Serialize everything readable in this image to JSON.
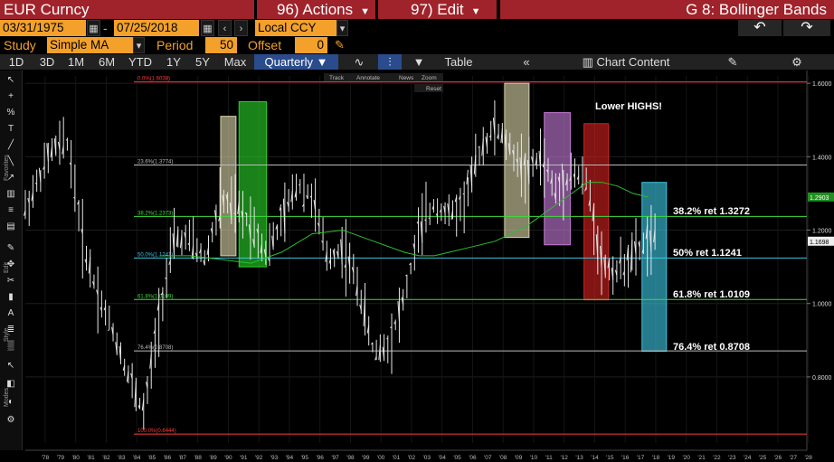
{
  "header": {
    "title": "EUR Curncy",
    "actions_label": "96) Actions",
    "edit_label": "97) Edit",
    "graph_title": "G 8: Bollinger Bands"
  },
  "date_range": {
    "start": "03/31/1975",
    "separator": "-",
    "end": "07/25/2018",
    "currency": "Local CCY"
  },
  "study": {
    "label": "Study",
    "value": "Simple MA",
    "period_label": "Period",
    "period_value": "50",
    "offset_label": "Offset",
    "offset_value": "0"
  },
  "toolbar": {
    "ranges": [
      "1D",
      "3D",
      "1M",
      "6M",
      "YTD",
      "1Y",
      "5Y",
      "Max"
    ],
    "frequency": "Quarterly",
    "table_label": "Table",
    "chart_content_label": "Chart Content"
  },
  "chart_tools": {
    "track": "Track",
    "annotate": "Annotate",
    "news": "News",
    "zoom": "Zoom",
    "reset": "Reset"
  },
  "side_labels": {
    "favorites": "Favorites",
    "edit": "Edit",
    "style": "Style",
    "modes": "Modes"
  },
  "annotations": {
    "lower_highs": "Lower HIGHS!",
    "ret382": "38.2% ret 1.3272",
    "ret50": "50% ret 1.1241",
    "ret618": "61.8% ret 1.0109",
    "ret764": "76.4% ret 0.8708"
  },
  "chart_data": {
    "type": "candlestick",
    "title": "",
    "ylim": [
      0.62,
      1.62
    ],
    "y_ticks": [
      "0.8000",
      "1.0000",
      "1.2000",
      "1.4000",
      "1.6000"
    ],
    "x_ticks": [
      "'78",
      "'79",
      "'80",
      "'81",
      "'82",
      "'83",
      "'84",
      "'85",
      "'86",
      "'87",
      "'88",
      "'89",
      "'90",
      "'91",
      "'92",
      "'93",
      "'94",
      "'95",
      "'96",
      "'97",
      "'98",
      "'99",
      "'00",
      "'01",
      "'02",
      "'03",
      "'04",
      "'05",
      "'06",
      "'07",
      "'08",
      "'09",
      "'10",
      "'11",
      "'12",
      "'13",
      "'14",
      "'15",
      "'16",
      "'17",
      "'18",
      "'19",
      "'20",
      "'21",
      "'22",
      "'23",
      "'24",
      "'25",
      "'26",
      "'27",
      "'28"
    ],
    "last_price": "1.1698",
    "ma_last": "1.2903",
    "fib_levels": [
      {
        "label": "0.0%(1.6038)",
        "value": 1.6038,
        "color": "#ff3b3b"
      },
      {
        "label": "23.6%(1.3774)",
        "value": 1.3774,
        "color": "#bbbbbb"
      },
      {
        "label": "38.2%(1.2373)",
        "value": 1.2373,
        "color": "#3ddc3d"
      },
      {
        "label": "50.0%(1.1241)",
        "value": 1.1241,
        "color": "#3cc7e0"
      },
      {
        "label": "61.8%(1.0109)",
        "value": 1.0109,
        "color": "#3ddc3d"
      },
      {
        "label": "76.4%(0.8708)",
        "value": 0.8708,
        "color": "#bbbbbb"
      },
      {
        "label": "100.0%(0.6444)",
        "value": 0.6444,
        "color": "#ff3b3b"
      }
    ],
    "boxes": [
      {
        "x0": 1990.0,
        "x1": 1991.0,
        "y0": 1.13,
        "y1": 1.51,
        "color": "#d8d3a8"
      },
      {
        "x0": 1991.2,
        "x1": 1993.0,
        "y0": 1.1,
        "y1": 1.55,
        "color": "#28d228"
      },
      {
        "x0": 2008.6,
        "x1": 2010.2,
        "y0": 1.18,
        "y1": 1.6,
        "color": "#d8d3a8"
      },
      {
        "x0": 2011.2,
        "x1": 2012.9,
        "y0": 1.16,
        "y1": 1.52,
        "color": "#c57ad8"
      },
      {
        "x0": 2013.8,
        "x1": 2015.4,
        "y0": 1.01,
        "y1": 1.49,
        "color": "#d22020"
      },
      {
        "x0": 2017.6,
        "x1": 2019.2,
        "y0": 0.87,
        "y1": 1.33,
        "color": "#3cc7e0"
      }
    ],
    "series": [
      {
        "x": [
          1975,
          1976,
          1977,
          1978,
          1979,
          1980,
          1981,
          1982,
          1983,
          1984,
          1985,
          1986,
          1987,
          1988,
          1989,
          1990,
          1991,
          1992,
          1993,
          1994,
          1995,
          1996,
          1997,
          1998,
          1999,
          2000,
          2001,
          2002,
          2003,
          2004,
          2005,
          2006,
          2007,
          2008,
          2009,
          2010,
          2011,
          2012,
          2013,
          2014,
          2015,
          2016,
          2017,
          2018
        ],
        "y": [
          1.3,
          1.2,
          1.24,
          1.33,
          1.42,
          1.44,
          1.16,
          1.02,
          0.92,
          0.8,
          0.7,
          0.98,
          1.18,
          1.17,
          1.12,
          1.28,
          1.26,
          1.22,
          1.14,
          1.22,
          1.33,
          1.29,
          1.12,
          1.15,
          1.05,
          0.87,
          0.89,
          1.01,
          1.2,
          1.27,
          1.24,
          1.28,
          1.42,
          1.48,
          1.42,
          1.36,
          1.4,
          1.3,
          1.36,
          1.33,
          1.1,
          1.09,
          1.13,
          1.17
        ]
      },
      {
        "name": "MA",
        "x": [
          1986,
          1988,
          1990,
          1992,
          1994,
          1996,
          1998,
          2000,
          2002,
          2003,
          2004,
          2005,
          2006,
          2007,
          2008,
          2009,
          2010,
          2011,
          2012,
          2013,
          2014,
          2015,
          2016,
          2017,
          2018
        ],
        "y": [
          1.13,
          1.13,
          1.12,
          1.11,
          1.14,
          1.19,
          1.2,
          1.17,
          1.14,
          1.13,
          1.13,
          1.14,
          1.15,
          1.16,
          1.17,
          1.19,
          1.21,
          1.24,
          1.27,
          1.3,
          1.33,
          1.33,
          1.32,
          1.3,
          1.29
        ]
      }
    ]
  }
}
